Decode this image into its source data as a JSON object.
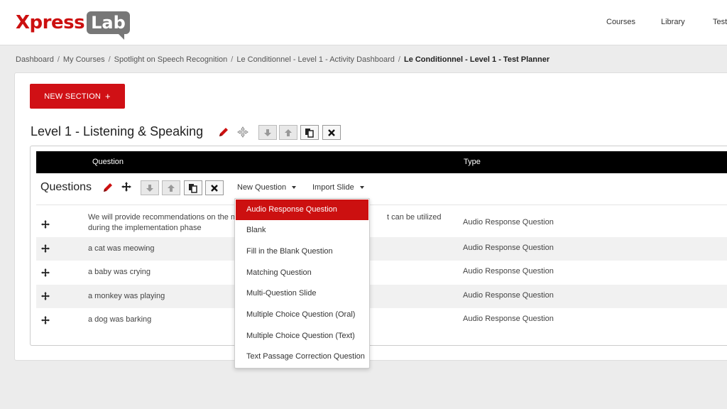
{
  "header": {
    "logo_part1": "Xpress",
    "logo_part2": "Lab",
    "nav": [
      "Courses",
      "Library",
      "Test"
    ]
  },
  "breadcrumb": {
    "items": [
      "Dashboard",
      "My Courses",
      "Spotlight on Speech Recognition",
      "Le Conditionnel - Level 1 - Activity Dashboard"
    ],
    "current": "Le Conditionnel - Level 1 - Test Planner",
    "separator": "/"
  },
  "main": {
    "new_section_label": "NEW SECTION",
    "new_section_icon": "+",
    "section_title": "Level 1 - Listening & Speaking",
    "table": {
      "headers": [
        "Question",
        "Type"
      ],
      "questions_title": "Questions",
      "new_question_label": "New Question",
      "import_slide_label": "Import Slide",
      "rows": [
        {
          "text_a": "We will provide recommendations on the mo",
          "text_b": "during the implementation phase",
          "text_c": "t can be utilized",
          "type": "Audio Response Question"
        },
        {
          "text_a": "a cat was meowing",
          "type": "Audio Response Question"
        },
        {
          "text_a": "a baby was crying",
          "type": "Audio Response Question"
        },
        {
          "text_a": "a monkey was playing",
          "type": "Audio Response Question"
        },
        {
          "text_a": "a dog was barking",
          "type": "Audio Response Question"
        }
      ]
    }
  },
  "menu": {
    "items": [
      "Audio Response Question",
      "Blank",
      "Fill in the Blank Question",
      "Matching Question",
      "Multi-Question Slide",
      "Multiple Choice Question (Oral)",
      "Multiple Choice Question (Text)",
      "Text Passage Correction Question"
    ],
    "active_index": 0
  },
  "colors": {
    "brand_red": "#cc1010",
    "header_bg": "#ffffff",
    "table_header_bg": "#000000",
    "row_alt_bg": "#f1f1f1"
  },
  "icons": [
    "pencil-icon",
    "move-icon",
    "arrow-down-icon",
    "arrow-up-icon",
    "copy-icon",
    "close-icon",
    "caret-down-icon"
  ]
}
